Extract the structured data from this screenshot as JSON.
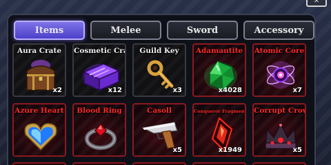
{
  "tabs": [
    {
      "label": "Items",
      "active": true
    },
    {
      "label": "Melee",
      "active": false
    },
    {
      "label": "Sword",
      "active": false
    },
    {
      "label": "Accessory",
      "active": false
    }
  ],
  "items": [
    {
      "name": "Aura Crate",
      "count": "x2",
      "rarity": "common",
      "icon": "crate-icon"
    },
    {
      "name": "Cosmetic Crate",
      "count": "x12",
      "rarity": "common",
      "icon": "purple-crate-icon"
    },
    {
      "name": "Guild Key",
      "count": "x3",
      "rarity": "common",
      "icon": "key-icon"
    },
    {
      "name": "Adamantite",
      "count": "x4028",
      "rarity": "rare",
      "icon": "green-gem-icon"
    },
    {
      "name": "Atomic Core",
      "count": "x7",
      "rarity": "rare",
      "icon": "atomic-orb-icon"
    },
    {
      "name": "Azure Heart",
      "count": "",
      "rarity": "rare",
      "icon": "blue-heart-icon"
    },
    {
      "name": "Blood Ring",
      "count": "",
      "rarity": "rare",
      "icon": "ring-icon"
    },
    {
      "name": "Casoll",
      "count": "x5",
      "rarity": "rare",
      "icon": "pistol-icon"
    },
    {
      "name": "Conqueror Fragment",
      "count": "x1949",
      "rarity": "rare",
      "icon": "red-fragment-icon"
    },
    {
      "name": "Corrupt Crown",
      "count": "x5",
      "rarity": "rare",
      "icon": "crown-icon"
    }
  ],
  "colors": {
    "active_tab": "#6357d8",
    "rare_border": "#8d1820",
    "rare_name": "#ff2a2a"
  }
}
